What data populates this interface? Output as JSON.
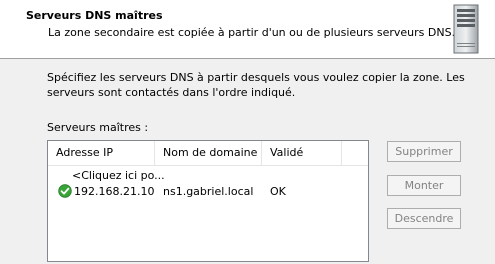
{
  "header": {
    "title": "Serveurs DNS maîtres",
    "subtitle": "La zone secondaire est copiée à partir d'un ou de plusieurs serveurs DNS."
  },
  "intro": "Spécifiez les serveurs DNS à partir desquels vous voulez copier la zone. Les serveurs sont contactés dans l'ordre indiqué.",
  "list": {
    "label": "Serveurs maîtres :",
    "columns": [
      "Adresse IP",
      "Nom de domaine ...",
      "Validé"
    ],
    "placeholder": "<Cliquez ici po...",
    "rows": [
      {
        "ip": "192.168.21.10",
        "domain": "ns1.gabriel.local",
        "validated": "OK",
        "status_icon": "check-circle-green"
      }
    ]
  },
  "buttons": {
    "delete": "Supprimer",
    "up": "Monter",
    "down": "Descendre"
  },
  "colors": {
    "ok_green": "#3aa537",
    "disabled_text": "#838383"
  }
}
